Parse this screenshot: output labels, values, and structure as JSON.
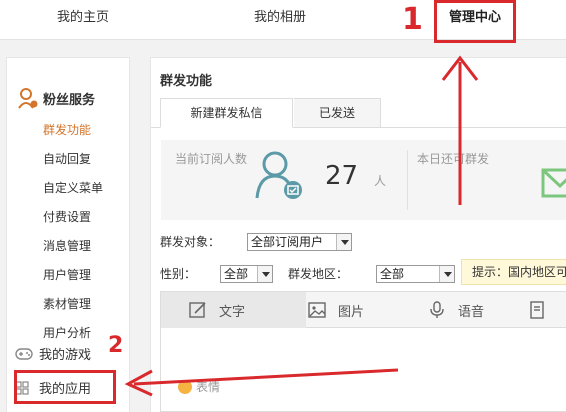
{
  "topnav": {
    "items": [
      {
        "label": "我的主页"
      },
      {
        "label": "我的相册"
      },
      {
        "label": "管理中心"
      }
    ]
  },
  "sidebar": {
    "section_title": "粉丝服务",
    "items": [
      {
        "label": "群发功能",
        "active": true
      },
      {
        "label": "自动回复"
      },
      {
        "label": "自定义菜单"
      },
      {
        "label": "付费设置"
      },
      {
        "label": "消息管理"
      },
      {
        "label": "用户管理"
      },
      {
        "label": "素材管理"
      },
      {
        "label": "用户分析"
      }
    ],
    "games_label": "我的游戏",
    "apps_label": "我的应用"
  },
  "main": {
    "title": "群发功能",
    "tabs": [
      {
        "label": "新建群发私信",
        "active": true
      },
      {
        "label": "已发送"
      }
    ],
    "stats": {
      "subscribers_label": "当前订阅人数",
      "subscribers_count": "27",
      "subscribers_unit": "人",
      "today_label": "本日还可群发"
    },
    "target_label": "群发对象：",
    "target_value": "全部订阅用户",
    "gender_label": "性别：",
    "gender_value": "全部",
    "region_label": "群发地区：",
    "region_value": "全部",
    "tip_text": "提示：国内地区可",
    "editor_tabs": [
      {
        "label": "文字",
        "icon": "edit-icon",
        "active": true
      },
      {
        "label": "图片",
        "icon": "image-icon"
      },
      {
        "label": "语音",
        "icon": "microphone-icon"
      },
      {
        "label": "",
        "icon": "document-icon"
      }
    ],
    "emoji_label": "表情"
  },
  "annotations": {
    "step1": "1",
    "step2": "2",
    "color": "#d9292c"
  },
  "colors": {
    "accent_orange": "#d4752c",
    "icon_teal": "#5b9aa6",
    "envelope_green": "#7cc67e"
  }
}
